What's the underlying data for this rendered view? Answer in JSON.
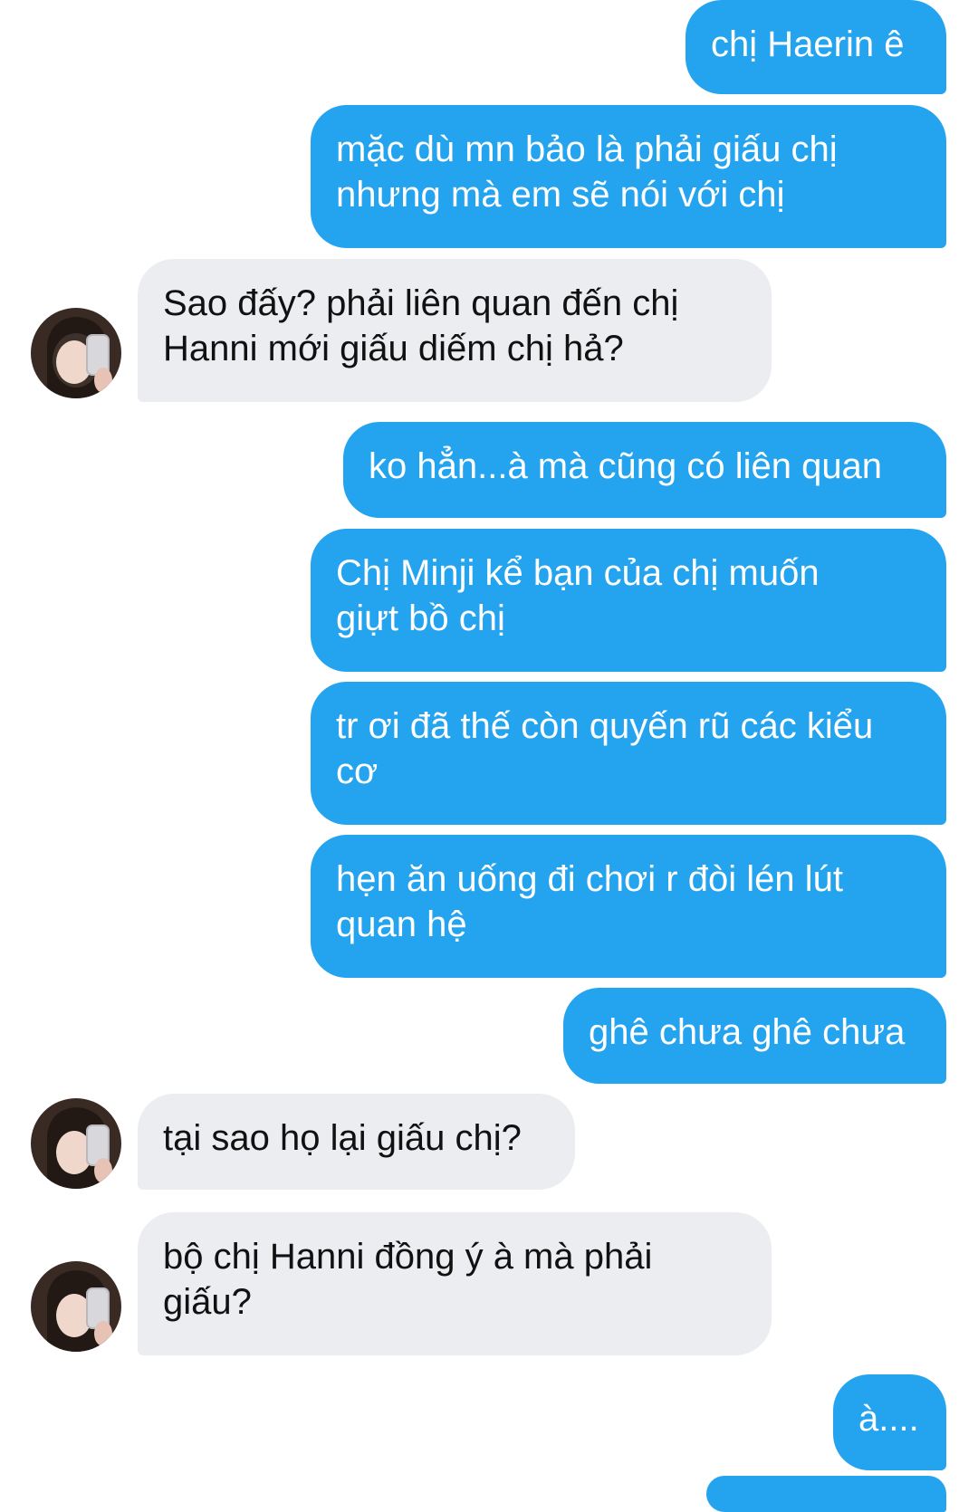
{
  "conversation": {
    "messages": [
      {
        "from": "me",
        "text": "chị Haerin ê"
      },
      {
        "from": "me",
        "text": "mặc dù mn bảo là phải giấu chị\nnhưng mà em sẽ nói với chị"
      },
      {
        "from": "other",
        "text": "Sao đấy? phải liên quan đến chị\nHanni mới giấu diếm chị hả?"
      },
      {
        "from": "me",
        "text": "ko hẳn...à mà cũng có liên quan"
      },
      {
        "from": "me",
        "text": "Chị Minji kể bạn của chị muốn\ngiựt bồ chị"
      },
      {
        "from": "me",
        "text": "tr ơi đã thế còn quyến rũ các kiểu\ncơ"
      },
      {
        "from": "me",
        "text": "hẹn ăn uống đi chơi r đòi lén lút\nquan hệ"
      },
      {
        "from": "me",
        "text": "ghê chưa ghê chưa"
      },
      {
        "from": "other",
        "text": "tại sao họ lại giấu chị?"
      },
      {
        "from": "other",
        "text": "bộ chị Hanni đồng ý à mà phải\ngiấu?"
      },
      {
        "from": "me",
        "text": "à...."
      }
    ]
  },
  "colors": {
    "sent_bubble": "#24a3ef",
    "received_bubble": "#ebedf0",
    "sent_text": "#ffffff",
    "received_text": "#111111"
  },
  "icons": {
    "avatar": "contact-avatar-photo"
  }
}
